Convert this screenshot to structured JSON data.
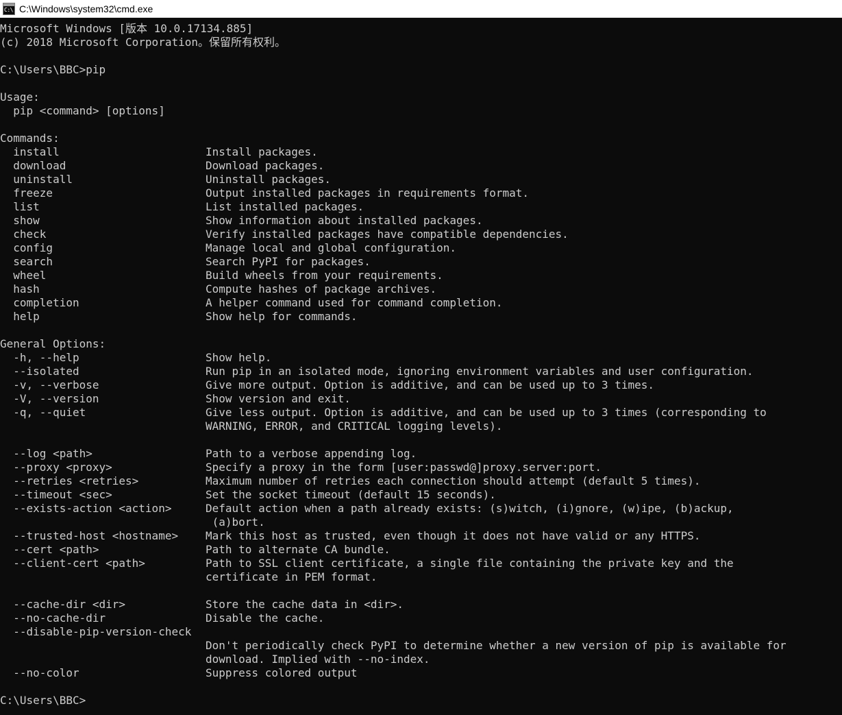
{
  "window": {
    "title": "C:\\Windows\\system32\\cmd.exe",
    "icon": "cmd-console-icon",
    "icon_glyph": "C:\\",
    "titlebar_bg": "#ffffff",
    "titlebar_fg": "#000000",
    "console_bg": "#0c0c0c",
    "console_fg": "#cccccc"
  },
  "console": {
    "banner": [
      "Microsoft Windows [版本 10.0.17134.885]",
      "(c) 2018 Microsoft Corporation。保留所有权利。"
    ],
    "prompt_line": "C:\\Users\\BBC>pip",
    "prompt_text": "C:\\Users\\BBC>",
    "command": "pip",
    "usage_header": "Usage:",
    "usage_line": "  pip <command> [options]",
    "commands_header": "Commands:",
    "commands": [
      {
        "name": "install",
        "desc": "Install packages."
      },
      {
        "name": "download",
        "desc": "Download packages."
      },
      {
        "name": "uninstall",
        "desc": "Uninstall packages."
      },
      {
        "name": "freeze",
        "desc": "Output installed packages in requirements format."
      },
      {
        "name": "list",
        "desc": "List installed packages."
      },
      {
        "name": "show",
        "desc": "Show information about installed packages."
      },
      {
        "name": "check",
        "desc": "Verify installed packages have compatible dependencies."
      },
      {
        "name": "config",
        "desc": "Manage local and global configuration."
      },
      {
        "name": "search",
        "desc": "Search PyPI for packages."
      },
      {
        "name": "wheel",
        "desc": "Build wheels from your requirements."
      },
      {
        "name": "hash",
        "desc": "Compute hashes of package archives."
      },
      {
        "name": "completion",
        "desc": "A helper command used for command completion."
      },
      {
        "name": "help",
        "desc": "Show help for commands."
      }
    ],
    "options_header": "General Options:",
    "options_group1": [
      {
        "flag": "-h, --help",
        "desc": "Show help.",
        "cont": []
      },
      {
        "flag": "--isolated",
        "desc": "Run pip in an isolated mode, ignoring environment variables and user configuration.",
        "cont": []
      },
      {
        "flag": "-v, --verbose",
        "desc": "Give more output. Option is additive, and can be used up to 3 times.",
        "cont": []
      },
      {
        "flag": "-V, --version",
        "desc": "Show version and exit.",
        "cont": []
      },
      {
        "flag": "-q, --quiet",
        "desc": "Give less output. Option is additive, and can be used up to 3 times (corresponding to",
        "cont": [
          "WARNING, ERROR, and CRITICAL logging levels)."
        ]
      }
    ],
    "options_group2": [
      {
        "flag": "--log <path>",
        "desc": "Path to a verbose appending log.",
        "cont": []
      },
      {
        "flag": "--proxy <proxy>",
        "desc": "Specify a proxy in the form [user:passwd@]proxy.server:port.",
        "cont": []
      },
      {
        "flag": "--retries <retries>",
        "desc": "Maximum number of retries each connection should attempt (default 5 times).",
        "cont": []
      },
      {
        "flag": "--timeout <sec>",
        "desc": "Set the socket timeout (default 15 seconds).",
        "cont": []
      },
      {
        "flag": "--exists-action <action>",
        "desc": "Default action when a path already exists: (s)witch, (i)gnore, (w)ipe, (b)ackup,",
        "cont": [
          " (a)bort."
        ]
      },
      {
        "flag": "--trusted-host <hostname>",
        "desc": "Mark this host as trusted, even though it does not have valid or any HTTPS.",
        "cont": []
      },
      {
        "flag": "--cert <path>",
        "desc": "Path to alternate CA bundle.",
        "cont": []
      },
      {
        "flag": "--client-cert <path>",
        "desc": "Path to SSL client certificate, a single file containing the private key and the",
        "cont": [
          "certificate in PEM format."
        ]
      }
    ],
    "options_group3": [
      {
        "flag": "--cache-dir <dir>",
        "desc": "Store the cache data in <dir>.",
        "cont": []
      },
      {
        "flag": "--no-cache-dir",
        "desc": "Disable the cache.",
        "cont": []
      }
    ],
    "option_wide": {
      "flag": "--disable-pip-version-check",
      "desc_lines": [
        "Don't periodically check PyPI to determine whether a new version of pip is available for",
        "download. Implied with --no-index."
      ]
    },
    "options_group4": [
      {
        "flag": "--no-color",
        "desc": "Suppress colored output",
        "cont": []
      }
    ],
    "final_prompt": "C:\\Users\\BBC>"
  }
}
